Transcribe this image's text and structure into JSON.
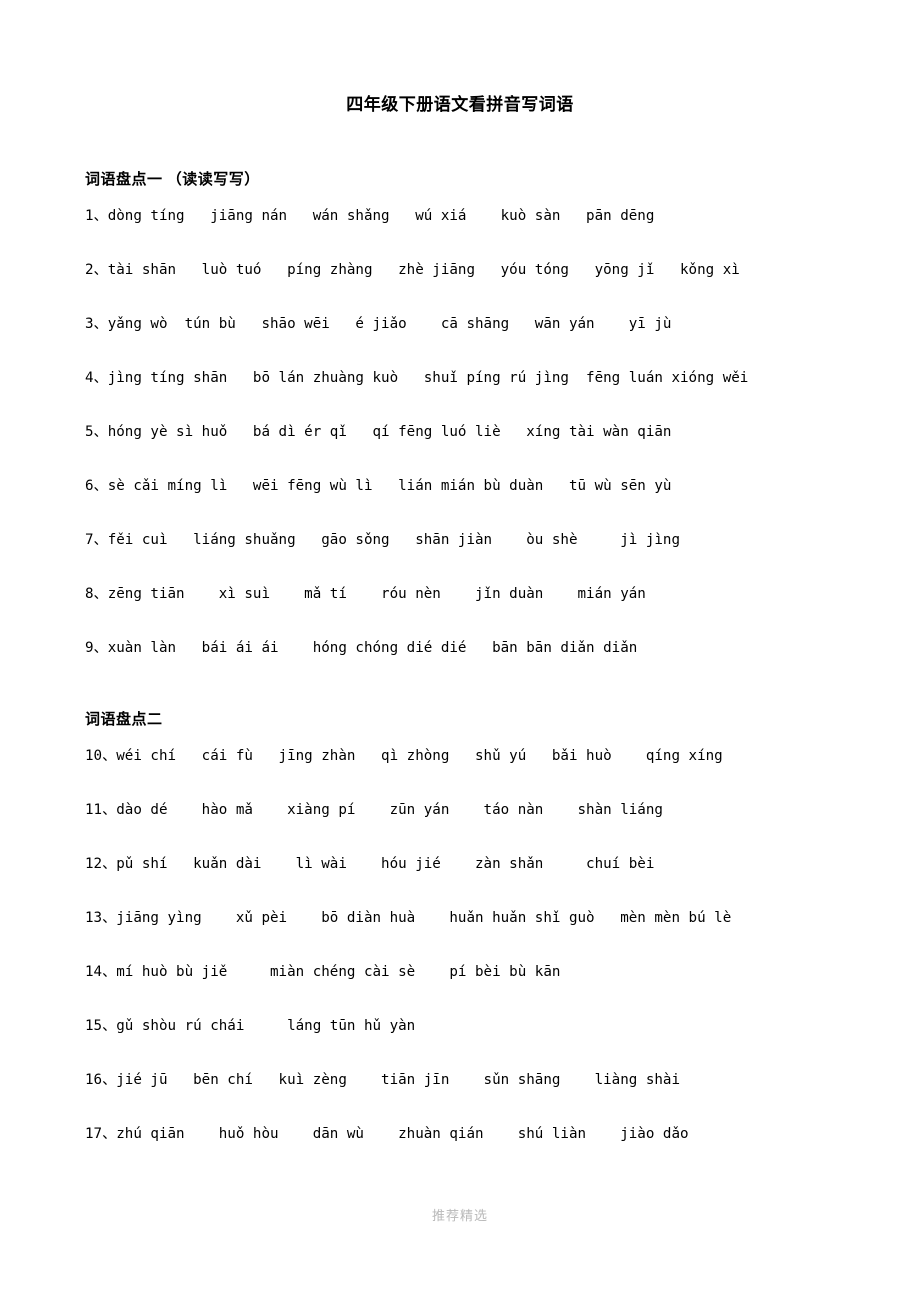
{
  "document": {
    "title": "四年级下册语文看拼音写词语",
    "footer_note": "推荐精选"
  },
  "sections": [
    {
      "heading": "词语盘点一 （读读写写）",
      "lines": [
        "1、dòng tíng   jiāng nán   wán shǎng   wú xiá    kuò sàn   pān dēng",
        "2、tài shān   luò tuó   píng zhàng   zhè jiāng   yóu tóng   yōng jǐ   kǒng xì",
        "3、yǎng wò  tún bù   shāo wēi   é jiǎo    cā shāng   wān yán    yī jù",
        "4、jìng tíng shān   bō lán zhuàng kuò   shuǐ píng rú jìng  fēng luán xióng wěi",
        "5、hóng yè sì huǒ   bá dì ér qǐ   qí fēng luó liè   xíng tài wàn qiān",
        "6、sè cǎi míng lì   wēi fēng wù lì   lián mián bù duàn   tū wù sēn yù",
        "7、fěi cuì   liáng shuǎng   gāo sǒng   shān jiàn    òu shè     jì jìng",
        "8、zēng tiān    xì suì    mǎ tí    róu nèn    jǐn duàn    mián yán",
        "9、xuàn làn   bái ái ái    hóng chóng dié dié   bān bān diǎn diǎn"
      ]
    },
    {
      "heading": "词语盘点二",
      "lines": [
        "10、wéi chí   cái fù   jīng zhàn   qì zhòng   shǔ yú   bǎi huò    qíng xíng",
        "11、dào dé    hào mǎ    xiàng pí    zūn yán    táo nàn    shàn liáng",
        "12、pǔ shí   kuǎn dài    lì wài    hóu jié    zàn shǎn     chuí bèi",
        "13、jiāng yìng    xǔ pèi    bō diàn huà    huǎn huǎn shǐ guò   mèn mèn bú lè",
        "14、mí huò bù jiě     miàn chéng cài sè    pí bèi bù kān",
        "15、gǔ shòu rú chái     láng tūn hǔ yàn",
        "16、jié jū   bēn chí   kuì zèng    tiān jīn    sǔn shāng    liàng shài",
        "17、zhú qiān    huǒ hòu    dān wù    zhuàn qián    shú liàn    jiào dǎo"
      ]
    }
  ]
}
